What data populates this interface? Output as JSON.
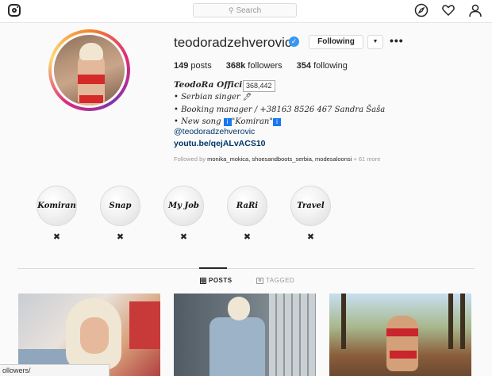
{
  "search": {
    "placeholder": "Search"
  },
  "profile": {
    "username": "teodoradzehverovic",
    "verified_mark": "✓",
    "follow_button": "Following",
    "dropdown_icon": "▼",
    "more_icon": "•••",
    "stats": {
      "posts": "149",
      "posts_label": "posts",
      "followers": "368k",
      "followers_label": "followers",
      "following": "354",
      "following_label": "following"
    },
    "bio": {
      "name": "TeodoRa Offici",
      "lines": [
        "• Serbian singer",
        "• Booking manager / +38163 8526 467 Sandra Šaša",
        "• New song",
        "\"Komiran\"",
        "@teodoradzehverovic"
      ],
      "info_glyph": "i",
      "pen_glyph": "🖊",
      "link": "youtu.be/qejALvACS10"
    },
    "tooltip": "368,442",
    "followed_by": {
      "prefix": "Followed by",
      "names": "monika_mokica, shoesandboots_serbia, modesaloonsi",
      "more": "+ 61 more"
    }
  },
  "highlights": [
    {
      "label": "Komiran"
    },
    {
      "label": "Snap"
    },
    {
      "label": "My Job"
    },
    {
      "label": "RaRi"
    },
    {
      "label": "Travel"
    }
  ],
  "highlight_remove_icon": "✖",
  "tabs": {
    "posts": "POSTS",
    "tagged": "TAGGED"
  },
  "status_bar": {
    "url": "ollowers/"
  },
  "colors": {
    "accent": "#3897f0",
    "link": "#003569",
    "text": "#262626",
    "muted": "#999999"
  }
}
